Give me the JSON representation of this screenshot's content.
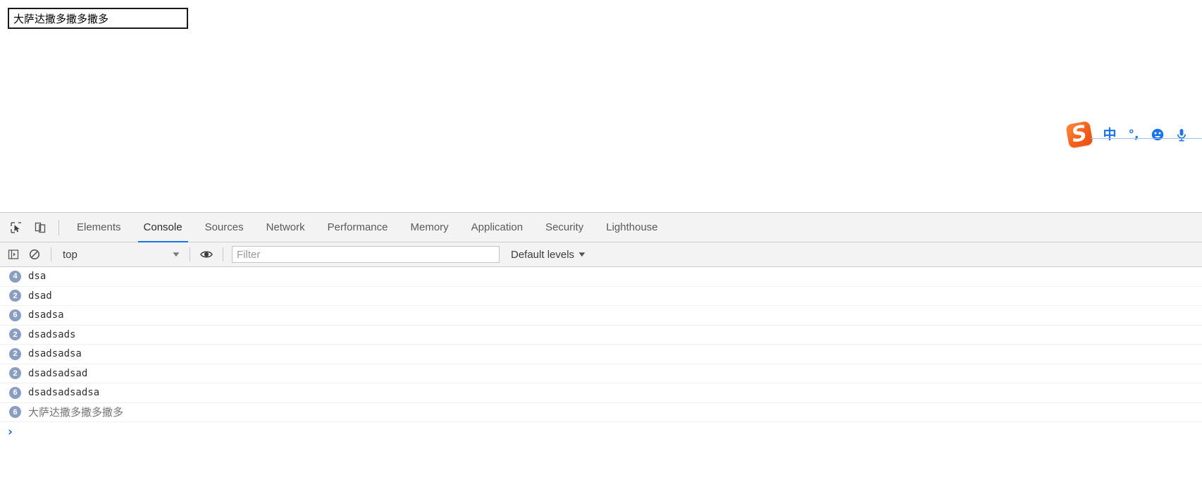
{
  "page": {
    "input_value": "大萨达撒多撒多撒多",
    "input_placeholder": ""
  },
  "ime": {
    "logo_letter": "S",
    "logo_name": "sogou-logo",
    "buttons": [
      {
        "name": "chinese-mode-icon",
        "glyph": "中",
        "label": "中文"
      },
      {
        "name": "punctuation-mode-icon",
        "glyph": "°,",
        "label": "中文标点"
      },
      {
        "name": "emoji-icon",
        "glyph": "☺",
        "label": "表情"
      },
      {
        "name": "voice-input-icon",
        "glyph": "🎤",
        "label": "语音输入"
      }
    ],
    "accent_color": "#1a73e8",
    "logo_color": "#f4601c"
  },
  "devtools": {
    "tabs": [
      {
        "label": "Elements",
        "active": false
      },
      {
        "label": "Console",
        "active": true
      },
      {
        "label": "Sources",
        "active": false
      },
      {
        "label": "Network",
        "active": false
      },
      {
        "label": "Performance",
        "active": false
      },
      {
        "label": "Memory",
        "active": false
      },
      {
        "label": "Application",
        "active": false
      },
      {
        "label": "Security",
        "active": false
      },
      {
        "label": "Lighthouse",
        "active": false
      }
    ],
    "active_tab_color": "#1a73e8",
    "toolbar_icons": {
      "inspect": "inspect-element-icon",
      "device": "device-toolbar-icon"
    },
    "filterbar": {
      "sidebar_toggle": "console-sidebar-icon",
      "clear_console": "clear-console-icon",
      "context": "top",
      "context_caret": "▼",
      "eye": "live-expression-icon",
      "filter_placeholder": "Filter",
      "filter_value": "",
      "levels_label": "Default levels",
      "levels_caret": "▼"
    },
    "console_messages": [
      {
        "count": "4",
        "text": "dsa",
        "cjk": false
      },
      {
        "count": "2",
        "text": "dsad",
        "cjk": false
      },
      {
        "count": "6",
        "text": "dsadsa",
        "cjk": false
      },
      {
        "count": "2",
        "text": "dsadsads",
        "cjk": false
      },
      {
        "count": "2",
        "text": "dsadsadsa",
        "cjk": false
      },
      {
        "count": "2",
        "text": "dsadsadsad",
        "cjk": false
      },
      {
        "count": "6",
        "text": "dsadsadsadsa",
        "cjk": false
      },
      {
        "count": "6",
        "text": "大萨达撒多撒多撒多",
        "cjk": true
      }
    ],
    "prompt_chevron": "›",
    "badge_color": "#8a9ec4"
  }
}
